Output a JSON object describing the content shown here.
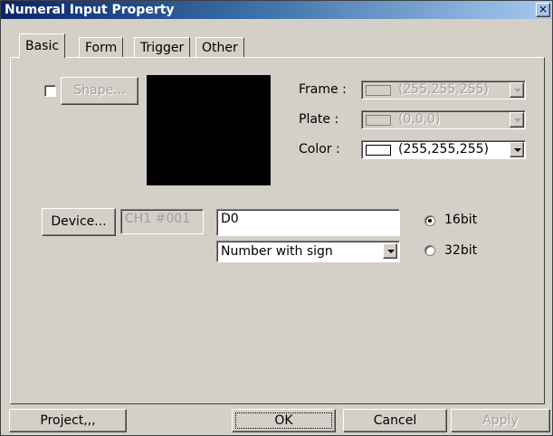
{
  "window": {
    "title": "Numeral Input Property",
    "close": "×"
  },
  "tabs": [
    {
      "label": "Basic",
      "active": true
    },
    {
      "label": "Form",
      "active": false
    },
    {
      "label": "Trigger",
      "active": false
    },
    {
      "label": "Other",
      "active": false
    }
  ],
  "basic": {
    "shape_button": "Shape...",
    "shape_checked": false,
    "frame": {
      "label": "Frame :",
      "value": "(255,255,255)",
      "enabled": false,
      "swatch": "#d4d0c8"
    },
    "plate": {
      "label": "Plate :",
      "value": "(0,0,0)",
      "enabled": false,
      "swatch": "#d4d0c8"
    },
    "color": {
      "label": "Color :",
      "value": "(255,255,255)",
      "enabled": true,
      "swatch": "#ffffff"
    },
    "preview_color": "#000000",
    "device_button": "Device...",
    "device_channel": "CH1 #001",
    "device_address": "D0",
    "number_format": "Number with sign",
    "bits": [
      {
        "label": "16bit",
        "selected": true
      },
      {
        "label": "32bit",
        "selected": false
      }
    ]
  },
  "footer": {
    "project": "Project,,,",
    "ok": "OK",
    "cancel": "Cancel",
    "apply": "Apply"
  }
}
